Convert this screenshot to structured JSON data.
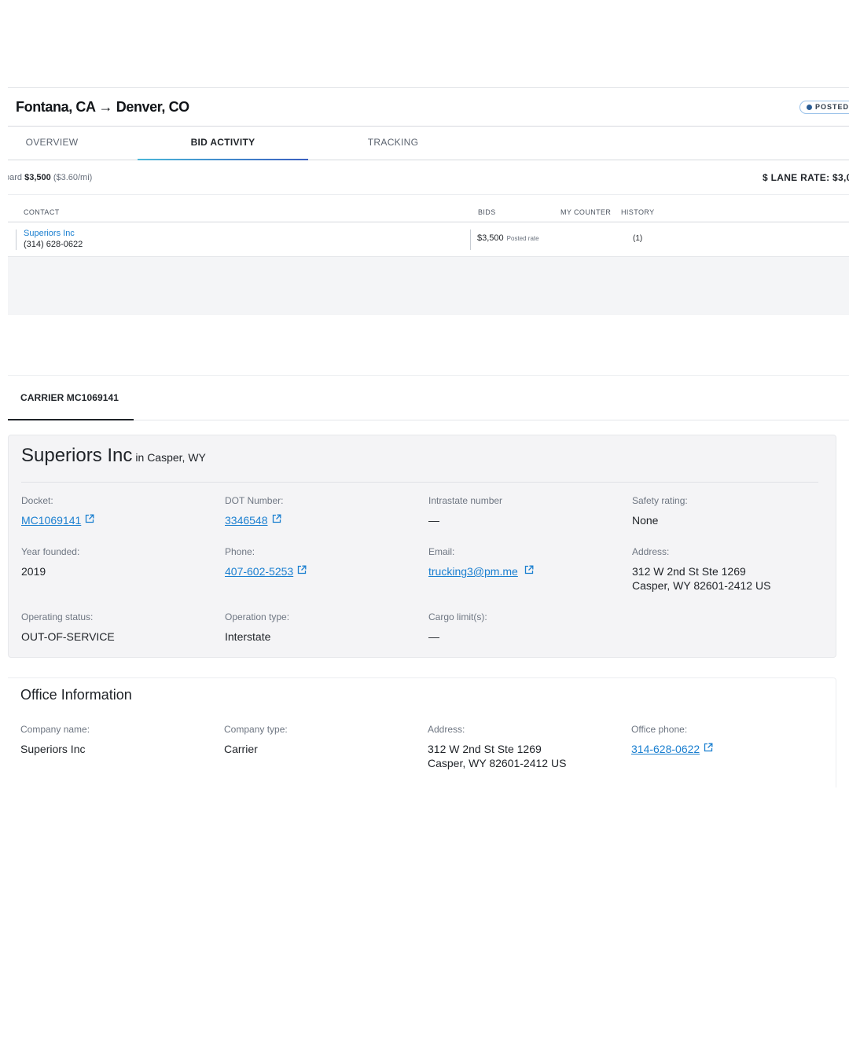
{
  "load": {
    "title": "Fontana, CA → Denver, CO",
    "status_badge": "POSTED",
    "tabs": [
      {
        "label": "OVERVIEW"
      },
      {
        "label": "BID ACTIVITY"
      },
      {
        "label": "TRACKING"
      }
    ],
    "rate_prefix": "oard",
    "rate_amount": "$3,500",
    "rate_per_mile": "($3.60/mi)",
    "lane_rate": "$ LANE RATE: $3,0",
    "bids_columns": [
      "CONTACT",
      "BIDS",
      "MY COUNTER",
      "HISTORY"
    ],
    "bids_rows": [
      {
        "contact_name": "Superiors Inc",
        "contact_phone": "(314) 628-0622",
        "bid": "$3,500",
        "bid_note": "Posted rate",
        "history": "(1)"
      }
    ]
  },
  "carrier": {
    "tab_label": "CARRIER MC1069141",
    "name": "Superiors Inc",
    "location": "in Casper, WY",
    "fields": {
      "docket_label": "Docket:",
      "docket_value": "MC1069141",
      "dot_label": "DOT Number:",
      "dot_value": "3346548",
      "intrastate_label": "Intrastate number",
      "intrastate_value": "—",
      "safety_label": "Safety rating:",
      "safety_value": "None",
      "year_label": "Year founded:",
      "year_value": "2019",
      "phone_label": "Phone:",
      "phone_value": "407-602-5253",
      "email_label": "Email:",
      "email_value": "trucking3@pm.me",
      "address_label": "Address:",
      "address_line1": "312 W 2nd St Ste 1269",
      "address_line2": "Casper, WY 82601-2412 US",
      "opstatus_label": "Operating status:",
      "opstatus_value": "OUT-OF-SERVICE",
      "optype_label": "Operation type:",
      "optype_value": "Interstate",
      "cargo_label": "Cargo limit(s):",
      "cargo_value": "—"
    }
  },
  "office": {
    "title": "Office Information",
    "company_name_label": "Company name:",
    "company_name_value": "Superiors Inc",
    "company_type_label": "Company type:",
    "company_type_value": "Carrier",
    "address_label": "Address:",
    "address_line1": "312 W 2nd St Ste 1269",
    "address_line2": "Casper, WY 82601-2412 US",
    "phone_label": "Office phone:",
    "phone_value": "314-628-0622"
  },
  "colors": {
    "link": "#1a7fd0",
    "tab_underline_start": "#4bb8d9",
    "tab_underline_end": "#3a5fc0",
    "panel_bg": "#f4f4f6"
  },
  "icons": {
    "external_link": "external-link-icon",
    "status_dot": "globe-dot-icon"
  }
}
